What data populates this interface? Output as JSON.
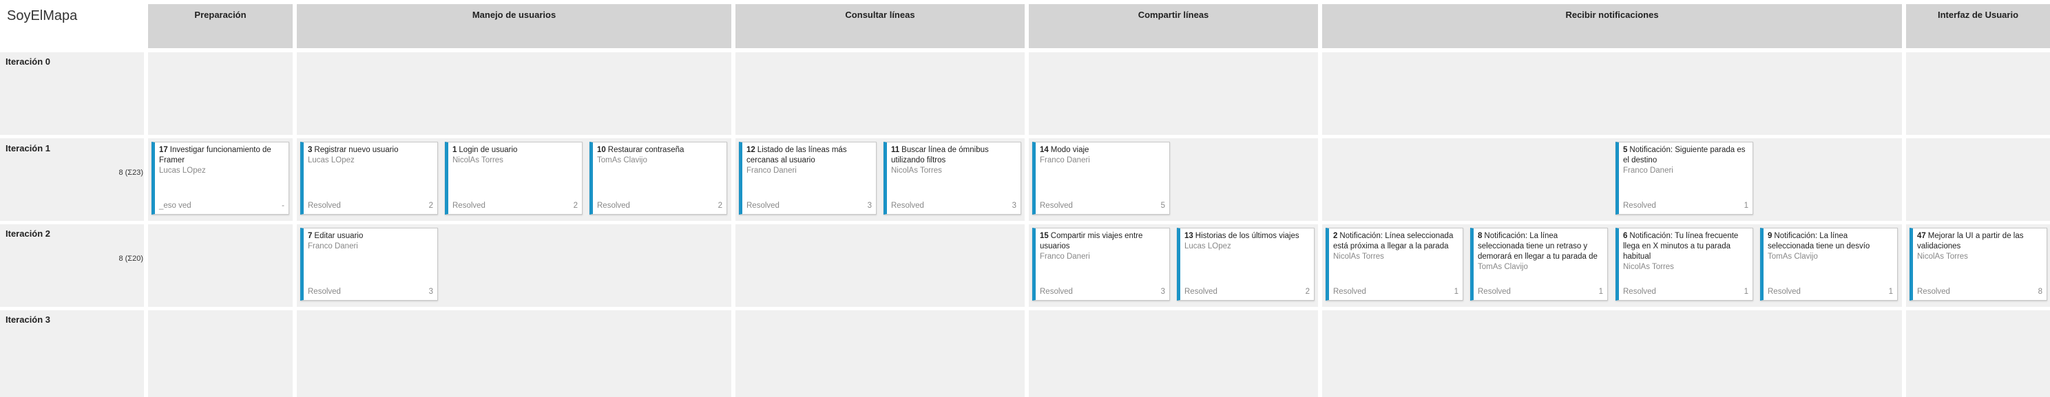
{
  "board": {
    "title": "SoyElMapa"
  },
  "columns": [
    "Preparación",
    "Manejo de usuarios",
    "Consultar líneas",
    "Compartir líneas",
    "Recibir notificaciones",
    "Interfaz de Usuario"
  ],
  "rows": [
    {
      "label": "Iteración 0",
      "meta": ""
    },
    {
      "label": "Iteración 1",
      "meta": "8 (Σ23)"
    },
    {
      "label": "Iteración 2",
      "meta": "8 (Σ20)"
    },
    {
      "label": "Iteración 3",
      "meta": ""
    }
  ],
  "cards": [
    {
      "id": "17",
      "title": "Investigar funcionamiento de Framer",
      "assignee": "Lucas LÓpez",
      "state": "_eso ved",
      "estimate": "-"
    },
    {
      "id": "3",
      "title": "Registrar nuevo usuario",
      "assignee": "Lucas LÓpez",
      "state": "Resolved",
      "estimate": "2"
    },
    {
      "id": "1",
      "title": "Login de usuario",
      "assignee": "NicolÁs Torres",
      "state": "Resolved",
      "estimate": "2"
    },
    {
      "id": "10",
      "title": "Restaurar contraseña",
      "assignee": "TomÁs Clavijo",
      "state": "Resolved",
      "estimate": "2"
    },
    {
      "id": "12",
      "title": "Listado de las líneas más cercanas al usuario",
      "assignee": "Franco Daneri",
      "state": "Resolved",
      "estimate": "3"
    },
    {
      "id": "11",
      "title": "Buscar línea de ómnibus utilizando filtros",
      "assignee": "NicolÁs Torres",
      "state": "Resolved",
      "estimate": "3"
    },
    {
      "id": "14",
      "title": "Modo viaje",
      "assignee": "Franco Daneri",
      "state": "Resolved",
      "estimate": "5"
    },
    {
      "id": "5",
      "title": "Notificación: Siguiente parada es el destino",
      "assignee": "Franco Daneri",
      "state": "Resolved",
      "estimate": "1"
    },
    {
      "id": "7",
      "title": "Editar usuario",
      "assignee": "Franco Daneri",
      "state": "Resolved",
      "estimate": "3"
    },
    {
      "id": "15",
      "title": "Compartir mis viajes entre usuarios",
      "assignee": "Franco Daneri",
      "state": "Resolved",
      "estimate": "3"
    },
    {
      "id": "13",
      "title": "Historias de los últimos viajes",
      "assignee": "Lucas LÓpez",
      "state": "Resolved",
      "estimate": "2"
    },
    {
      "id": "2",
      "title": "Notificación: Línea seleccionada está próxima a llegar a la parada",
      "assignee": "NicolÁs Torres",
      "state": "Resolved",
      "estimate": "1"
    },
    {
      "id": "8",
      "title": "Notificación: La línea seleccionada tiene un retraso y demorará en llegar a tu parada de",
      "assignee": "TomÁs Clavijo",
      "state": "Resolved",
      "estimate": "1"
    },
    {
      "id": "6",
      "title": "Notificación: Tu línea frecuente llega en X minutos a tu parada habitual",
      "assignee": "NicolÁs Torres",
      "state": "Resolved",
      "estimate": "1"
    },
    {
      "id": "9",
      "title": "Notificación: La línea seleccionada tiene un desvío",
      "assignee": "TomÁs Clavijo",
      "state": "Resolved",
      "estimate": "1"
    },
    {
      "id": "47",
      "title": "Mejorar la UI a partir de las validaciones",
      "assignee": "NicolÁs Torres",
      "state": "Resolved",
      "estimate": "8"
    }
  ],
  "colors": {
    "accent": "#1b93c6",
    "header_bg": "#d4d4d4",
    "cell_bg": "#f0f0f0"
  }
}
